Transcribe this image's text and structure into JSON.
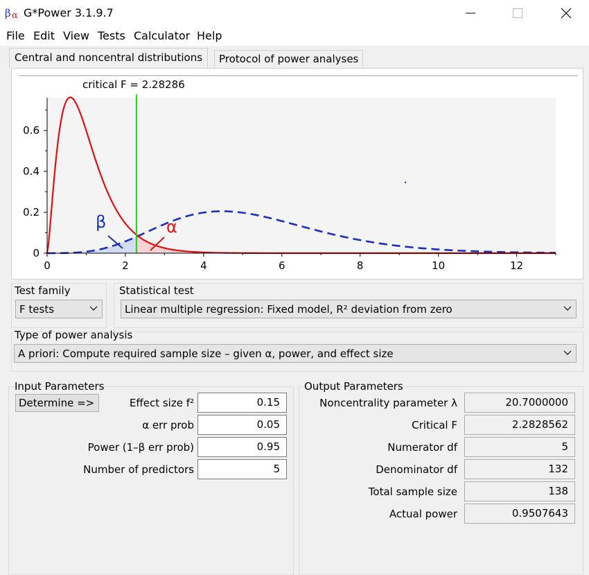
{
  "window": {
    "title": "G*Power 3.1.9.7",
    "icon": "beta-alpha-app-icon"
  },
  "menu": [
    "File",
    "Edit",
    "View",
    "Tests",
    "Calculator",
    "Help"
  ],
  "tabs": {
    "active": "Central and noncentral distributions",
    "inactive": "Protocol of power analyses"
  },
  "chart": {
    "critical_label": "critical F = 2.28286",
    "beta_symbol": "β",
    "alpha_symbol": "α",
    "colors": {
      "central": "#e01010",
      "noncentral": "#1a2fbf",
      "critical": "#20d020"
    }
  },
  "chart_data": {
    "type": "line",
    "series": [
      {
        "name": "",
        "style": "solid red",
        "dist": "central F",
        "df1": 5,
        "df2": 132
      },
      {
        "name": "",
        "style": "dashed blue",
        "dist": "noncentral F",
        "df1": 5,
        "df2": 132,
        "lambda": 20.7
      }
    ],
    "critical_x": 2.28286,
    "xlim": [
      0,
      13
    ],
    "ylim": [
      0,
      0.76
    ],
    "x_ticks": [
      "0",
      "2",
      "4",
      "6",
      "8",
      "10",
      "12"
    ],
    "y_ticks": [
      "0",
      "0.2",
      "0.4",
      "0.6"
    ]
  },
  "test_family": {
    "label": "Test family",
    "value": "F tests"
  },
  "statistical_test": {
    "label": "Statistical test",
    "value": "Linear multiple regression: Fixed model, R² deviation from zero"
  },
  "power_analysis": {
    "label": "Type of power analysis",
    "value": "A priori: Compute required sample size – given α, power, and effect size"
  },
  "input": {
    "title": "Input Parameters",
    "determine_label": "Determine =>",
    "fields": [
      {
        "label": "Effect size f²",
        "value": "0.15"
      },
      {
        "label": "α err prob",
        "value": "0.05"
      },
      {
        "label": "Power (1–β err prob)",
        "value": "0.95"
      },
      {
        "label": "Number of predictors",
        "value": "5"
      }
    ]
  },
  "output": {
    "title": "Output Parameters",
    "fields": [
      {
        "label": "Noncentrality parameter λ",
        "value": "20.7000000"
      },
      {
        "label": "Critical F",
        "value": "2.2828562"
      },
      {
        "label": "Numerator df",
        "value": "5"
      },
      {
        "label": "Denominator df",
        "value": "132"
      },
      {
        "label": "Total sample size",
        "value": "138"
      },
      {
        "label": "Actual power",
        "value": "0.9507643"
      }
    ]
  }
}
